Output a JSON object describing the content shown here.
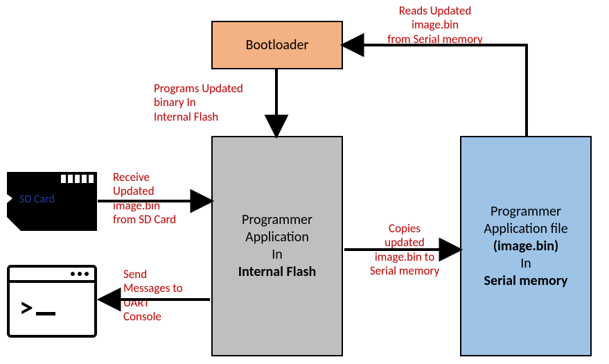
{
  "nodes": {
    "bootloader": "Bootloader",
    "programmer_app": {
      "l1": "Programmer",
      "l2": "Application",
      "l3": "In",
      "l4": "Internal Flash"
    },
    "serial_memory": {
      "l1": "Programmer",
      "l2": "Application file",
      "l3": "(image.bin)",
      "l4": "In",
      "l5": "Serial memory"
    },
    "sdcard": "SD Card"
  },
  "labels": {
    "reads_updated": {
      "l1": "Reads Updated",
      "l2": "image.bin",
      "l3": "from Serial memory"
    },
    "programs_updated": {
      "l1": "Programs Updated",
      "l2": "binary In",
      "l3": "Internal Flash"
    },
    "receive_updated": {
      "l1": "Receive",
      "l2": "Updated",
      "l3": "image.bin",
      "l4": "from SD Card"
    },
    "copies_updated": {
      "l1": "Copies",
      "l2": "updated",
      "l3": "image.bin to",
      "l4": "Serial memory"
    },
    "send_messages": {
      "l1": "Send",
      "l2": "Messages to",
      "l3": "UART",
      "l4": "Console"
    }
  },
  "terminal_prompt": ">"
}
